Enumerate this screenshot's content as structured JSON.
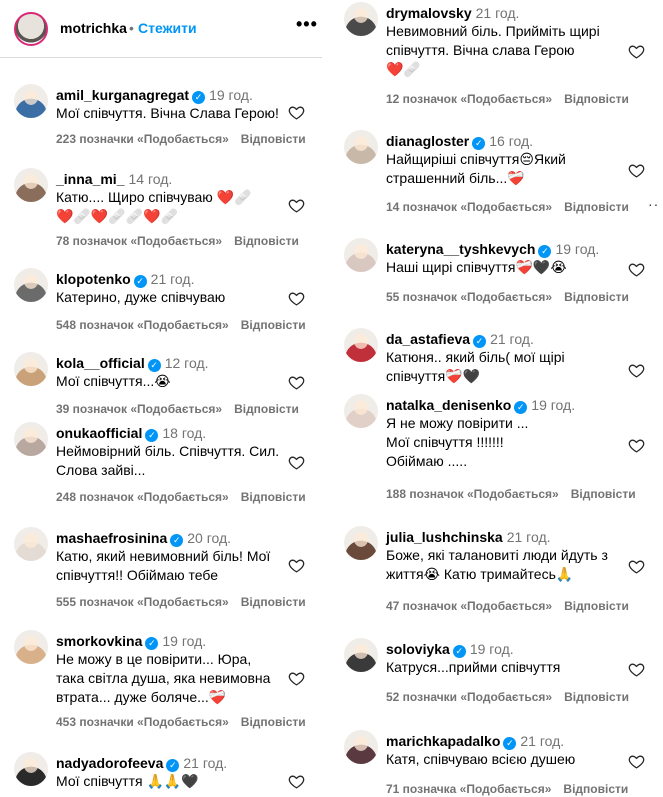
{
  "header": {
    "username": "motrichka",
    "separator": "•",
    "follow_label": "Стежити",
    "more_label": "•••"
  },
  "reply_label": "Відповісти",
  "verified_mark": "✓",
  "left_comments": [
    {
      "user": "amil_kurganagregat",
      "verified": true,
      "time": "19 год.",
      "text": "Мої співчуття. Вічна Слава Герою!",
      "likes": "223 позначки «Подобається»",
      "color": "#3a6ea5"
    },
    {
      "user": "_inna_mi_",
      "verified": false,
      "time": "14 год.",
      "text": "Катю.... Щиро співчуваю ❤️🩹\n❤️🩹❤️🩹🩹❤️🩹",
      "likes": "78 позначок «Подобається»",
      "color": "#8a6d5a"
    },
    {
      "user": "klopotenko",
      "verified": true,
      "time": "21 год.",
      "text": "Катерино, дуже співчуваю",
      "likes": "548 позначок «Подобається»",
      "color": "#6b6b6b"
    },
    {
      "user": "kola__official",
      "verified": true,
      "time": "12 год.",
      "text": "Мої співчуття...😭",
      "likes": "39 позначок «Подобається»",
      "color": "#c9a27a"
    },
    {
      "user": "onukaofficial",
      "verified": true,
      "time": "18 год.",
      "text": "Неймовірний біль. Співчуття. Сил.\nСлова зайві...",
      "likes": "248 позначок «Подобається»",
      "color": "#b8a8a0"
    },
    {
      "user": "mashaefrosinina",
      "verified": true,
      "time": "20 год.",
      "text": "Катю, який невимовний біль! Мої\nспівчуття!! Обіймаю тебе",
      "likes": "555 позначок «Подобається»",
      "color": "#e4dcd4"
    },
    {
      "user": "smorkovkina",
      "verified": true,
      "time": "19 год.",
      "text": "Не можу в це повірити... Юра,\nтака світла душа, яка невимовна\nвтрата... дуже боляче...❤️‍🩹",
      "likes": "453 позначки «Подобається»",
      "color": "#d8b08a"
    },
    {
      "user": "nadyadorofeeva",
      "verified": true,
      "time": "21 год.",
      "text": "Мої співчуття 🙏🙏🖤",
      "likes": "",
      "color": "#2a2a2a"
    }
  ],
  "right_comments": [
    {
      "user": "drymalovsky",
      "verified": false,
      "time": "21 год.",
      "text": "Невимовний біль. Прийміть щирі\nспівчуття. Вічна слава Герою\n❤️🩹",
      "likes": "12 позначок «Подобається»",
      "color": "#4a4a4a"
    },
    {
      "user": "dianagloster",
      "verified": true,
      "time": "16 год.",
      "text": "Найщиріші співчуття😔Який\nстрашенний біль...❤️‍🩹",
      "likes": "14 позначок «Подобається»",
      "color": "#c8b8a8"
    },
    {
      "user": "kateryna__tyshkevych",
      "verified": true,
      "time": "19 год.",
      "text": "Наші щирі співчуття❤️‍🩹🖤😭",
      "likes": "55 позначок «Подобається»",
      "color": "#d8c8c0"
    },
    {
      "user": "da_astafieva",
      "verified": true,
      "time": "21 год.",
      "text": "Катюня.. який біль( мої щірі\nспівчуття❤️‍🩹🖤",
      "likes": "",
      "color": "#c0303a"
    },
    {
      "user": "natalka_denisenko",
      "verified": true,
      "time": "19 год.",
      "text": "Я не можу повірити ...\nМої співчуття !!!!!!!\nОбіймаю .....",
      "likes": "188 позначок «Подобається»",
      "color": "#e0d0c8"
    },
    {
      "user": "julia_lushchinska",
      "verified": false,
      "time": "21 год.",
      "text": "Боже, які талановиті люди йдуть з\nжиття😭 Катю тримайтесь🙏",
      "likes": "47 позначок «Подобається»",
      "color": "#6a4a3a"
    },
    {
      "user": "soloviyka",
      "verified": true,
      "time": "19 год.",
      "text": "Катруся...прийми співчуття",
      "likes": "52 позначки «Подобається»",
      "color": "#3a3a3a"
    },
    {
      "user": "marichkapadalko",
      "verified": true,
      "time": "21 год.",
      "text": "Катя, співчуваю всією душею",
      "likes": "71 позначка «Подобається»",
      "color": "#5a3a40"
    }
  ],
  "colors": {
    "accent": "#0095f6",
    "muted": "#737373",
    "divider": "#dbdbdb"
  }
}
